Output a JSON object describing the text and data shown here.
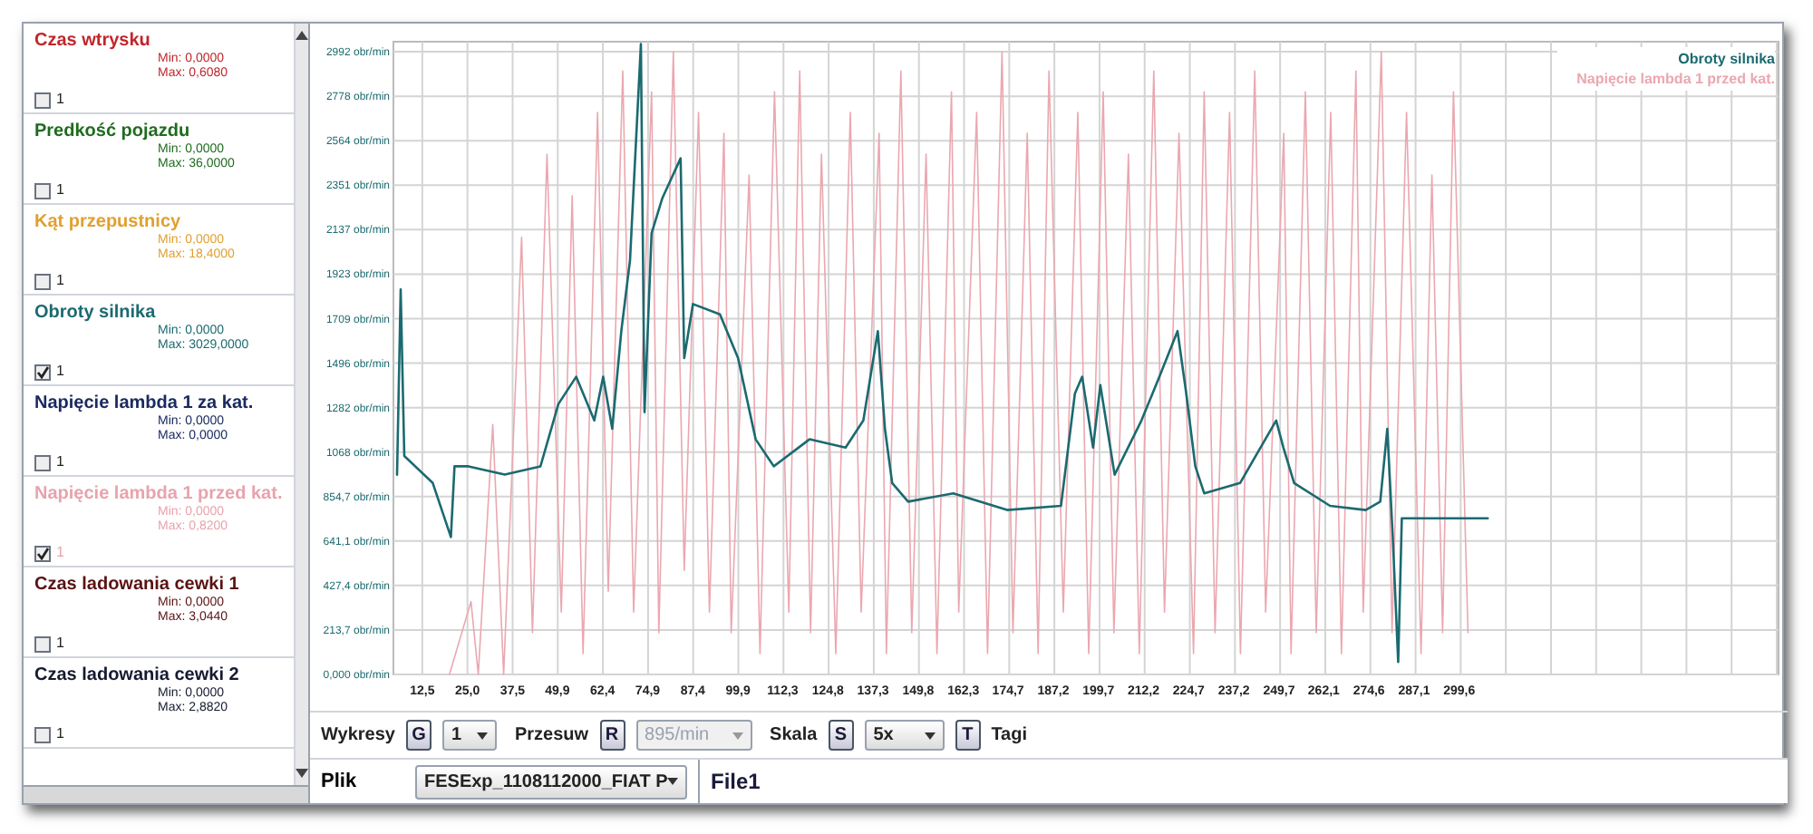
{
  "channels": [
    {
      "name": "Czas wtrysku",
      "min": "Min: 0,0000",
      "max": "Max: 0,6080",
      "checked": false,
      "label": "1",
      "color": "#c0262b"
    },
    {
      "name": "Predkość pojazdu",
      "min": "Min: 0,0000",
      "max": "Max: 36,0000",
      "checked": false,
      "label": "1",
      "color": "#1f6b1f"
    },
    {
      "name": "Kąt przepustnicy",
      "min": "Min: 0,0000",
      "max": "Max: 18,4000",
      "checked": false,
      "label": "1",
      "color": "#e0a030"
    },
    {
      "name": "Obroty silnika",
      "min": "Min: 0,0000",
      "max": "Max: 3029,0000",
      "checked": true,
      "label": "1",
      "color": "#1b6a70"
    },
    {
      "name": "Napięcie lambda 1 za kat.",
      "min": "Min: 0,0000",
      "max": "Max: 0,0000",
      "checked": false,
      "label": "1",
      "color": "#1a2a60"
    },
    {
      "name": "Napięcie lambda 1 przed kat.",
      "min": "Min: 0,0000",
      "max": "Max: 0,8200",
      "checked": true,
      "label": "1",
      "color": "#e8a3ad"
    },
    {
      "name": "Czas ladowania cewki 1",
      "min": "Min: 0,0000",
      "max": "Max: 3,0440",
      "checked": false,
      "label": "1",
      "color": "#5a1212"
    },
    {
      "name": "Czas ladowania cewki 2",
      "min": "Min: 0,0000",
      "max": "Max: 2,8820",
      "checked": false,
      "label": "1",
      "color": "#151a30"
    }
  ],
  "chart": {
    "chart_data": {
      "type": "line",
      "xlim": [
        4.5,
        388
      ],
      "ylim": [
        0,
        3040
      ],
      "grid": true,
      "xticks": [
        {
          "value": 12.5,
          "label": "12,5"
        },
        {
          "value": 25.0,
          "label": "25,0"
        },
        {
          "value": 37.5,
          "label": "37,5"
        },
        {
          "value": 49.9,
          "label": "49,9"
        },
        {
          "value": 62.4,
          "label": "62,4"
        },
        {
          "value": 74.9,
          "label": "74,9"
        },
        {
          "value": 87.4,
          "label": "87,4"
        },
        {
          "value": 99.9,
          "label": "99,9"
        },
        {
          "value": 112.3,
          "label": "112,3"
        },
        {
          "value": 124.8,
          "label": "124,8"
        },
        {
          "value": 137.3,
          "label": "137,3"
        },
        {
          "value": 149.8,
          "label": "149,8"
        },
        {
          "value": 162.3,
          "label": "162,3"
        },
        {
          "value": 174.7,
          "label": "174,7"
        },
        {
          "value": 187.2,
          "label": "187,2"
        },
        {
          "value": 199.7,
          "label": "199,7"
        },
        {
          "value": 212.2,
          "label": "212,2"
        },
        {
          "value": 224.7,
          "label": "224,7"
        },
        {
          "value": 237.2,
          "label": "237,2"
        },
        {
          "value": 249.7,
          "label": "249,7"
        },
        {
          "value": 262.1,
          "label": "262,1"
        },
        {
          "value": 274.6,
          "label": "274,6"
        },
        {
          "value": 287.1,
          "label": "287,1"
        },
        {
          "value": 299.6,
          "label": "299,6"
        }
      ],
      "yticks": [
        {
          "value": 0,
          "label": "0,000 obr/min"
        },
        {
          "value": 213.7,
          "label": "213,7 obr/min"
        },
        {
          "value": 427.4,
          "label": "427,4 obr/min"
        },
        {
          "value": 641.1,
          "label": "641,1 obr/min"
        },
        {
          "value": 854.7,
          "label": "854,7 obr/min"
        },
        {
          "value": 1068,
          "label": "1068 obr/min"
        },
        {
          "value": 1282,
          "label": "1282 obr/min"
        },
        {
          "value": 1496,
          "label": "1496 obr/min"
        },
        {
          "value": 1709,
          "label": "1709 obr/min"
        },
        {
          "value": 1923,
          "label": "1923 obr/min"
        },
        {
          "value": 2137,
          "label": "2137 obr/min"
        },
        {
          "value": 2351,
          "label": "2351 obr/min"
        },
        {
          "value": 2564,
          "label": "2564 obr/min"
        },
        {
          "value": 2778,
          "label": "2778 obr/min"
        },
        {
          "value": 2992,
          "label": "2992 obr/min"
        }
      ],
      "x": [
        5.5,
        6.5,
        7.5,
        15.4,
        20.4,
        21.4,
        25.3,
        35.3,
        45.2,
        50.2,
        55.1,
        60.1,
        62.6,
        65.1,
        67.6,
        70.0,
        73.0,
        74.0,
        76.0,
        79.0,
        84.0,
        85.0,
        87.4,
        94.9,
        99.9,
        104.8,
        109.8,
        119.7,
        129.7,
        134.6,
        138.6,
        140.6,
        142.6,
        147.0,
        159.5,
        174.4,
        189.3,
        193.2,
        195.2,
        198.2,
        200.2,
        204.2,
        211.6,
        216.6,
        221.6,
        224.0,
        226.5,
        229.0,
        238.9,
        248.9,
        250.9,
        253.9,
        263.8,
        273.7,
        277.7,
        279.7,
        281.2,
        282.7,
        283.7,
        293.6,
        307.5
      ],
      "series": [
        {
          "name": "Obroty silnika",
          "color": "#1b6a70",
          "values": [
            960,
            1850,
            1050,
            920,
            660,
            1000,
            1000,
            960,
            1000,
            1300,
            1430,
            1220,
            1430,
            1180,
            1650,
            1990,
            3029,
            1260,
            2120,
            2290,
            2480,
            1520,
            1780,
            1730,
            1520,
            1130,
            1000,
            1130,
            1090,
            1220,
            1650,
            1180,
            920,
            830,
            870,
            790,
            810,
            1350,
            1430,
            1090,
            1390,
            960,
            1220,
            1430,
            1650,
            1350,
            1000,
            870,
            920,
            1220,
            1090,
            920,
            810,
            790,
            830,
            1180,
            660,
            60,
            750,
            750,
            750
          ]
        },
        {
          "name": "Napięcie lambda 1 przed kat.",
          "color": "#eba7b0",
          "x": [
            20,
            26,
            28,
            32,
            35,
            40,
            43,
            47,
            51,
            54,
            57,
            61,
            64,
            68,
            71,
            76,
            78,
            82,
            85,
            89,
            92,
            96,
            98,
            103,
            106,
            110,
            114,
            117,
            120,
            123,
            127,
            131,
            134,
            139,
            141,
            145,
            148,
            152,
            155,
            159,
            161,
            166,
            169,
            173,
            176,
            180,
            183,
            186,
            190,
            194,
            197,
            201,
            204,
            208,
            211,
            215,
            218,
            222,
            226,
            229,
            232,
            236,
            239,
            243,
            246,
            251,
            253,
            257,
            260,
            264,
            267,
            271,
            273,
            278,
            281,
            285,
            289,
            292,
            295,
            298,
            302
          ],
          "values": [
            0,
            350,
            0,
            1200,
            0,
            2100,
            200,
            2500,
            300,
            2300,
            100,
            2700,
            400,
            2900,
            300,
            2800,
            200,
            2990,
            500,
            2700,
            300,
            2600,
            200,
            2400,
            100,
            2800,
            300,
            2900,
            200,
            2500,
            100,
            2700,
            300,
            2600,
            100,
            2900,
            200,
            2500,
            100,
            2800,
            300,
            2700,
            100,
            2990,
            200,
            2600,
            100,
            2900,
            300,
            2700,
            100,
            2800,
            200,
            2500,
            100,
            2900,
            300,
            2600,
            100,
            2800,
            200,
            2700,
            100,
            2900,
            300,
            2600,
            100,
            2800,
            200,
            2700,
            100,
            2900,
            300,
            2990,
            200,
            2700,
            100,
            2400,
            200,
            2800,
            200
          ]
        }
      ]
    }
  },
  "controls": {
    "charts_label": "Wykresy",
    "charts_key": "G",
    "charts_select": "1",
    "shift_label": "Przesuw",
    "shift_key": "R",
    "shift_select": {
      "value": "895/min",
      "disabled": true
    },
    "scale_label": "Skala",
    "scale_key": "S",
    "scale_select": "5x",
    "tags_key": "T",
    "tags_label": "Tagi"
  },
  "file": {
    "label": "Plik",
    "select": "FESExp_1108112000_FIAT P",
    "name": "File1"
  }
}
